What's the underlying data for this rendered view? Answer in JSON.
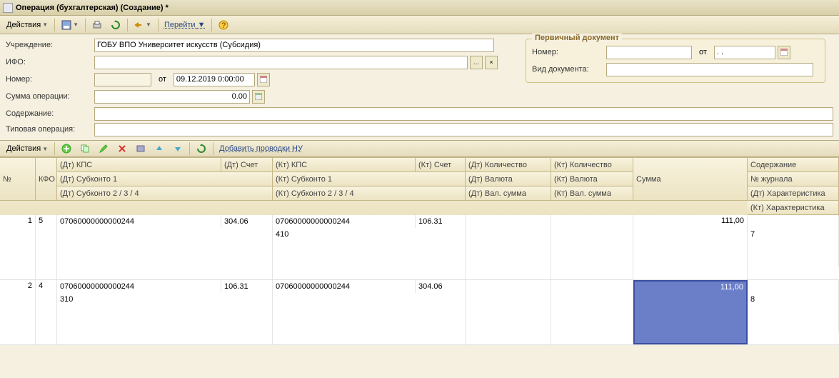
{
  "window": {
    "title": "Операция (бухгалтерская) (Создание) *"
  },
  "toolbar1": {
    "actions": "Действия",
    "go": "Перейти"
  },
  "form": {
    "institution_label": "Учреждение:",
    "institution_value": "ГОБУ ВПО Университет искусств (Субсидия)",
    "ifo_label": "ИФО:",
    "ifo_value": "",
    "number_label": "Номер:",
    "number_value": "",
    "from_label": "от",
    "date_value": "09.12.2019 0:00:00",
    "sum_label": "Сумма операции:",
    "sum_value": "0.00",
    "content_label": "Содержание:",
    "content_value": "",
    "typical_label": "Типовая операция:",
    "typical_value": ""
  },
  "primary_doc": {
    "legend": "Первичный документ",
    "number_label": "Номер:",
    "number_value": "",
    "from_label": "от",
    "date_value": ". .",
    "type_label": "Вид документа:",
    "type_value": ""
  },
  "toolbar2": {
    "actions": "Действия",
    "add_nu": "Добавить проводки НУ"
  },
  "grid_headers": {
    "no": "№",
    "kfo": "КФО",
    "dt_kps": "(Дт) КПС",
    "dt_acct": "(Дт) Счет",
    "kt_kps": "(Кт) КПС",
    "kt_acct": "(Кт) Счет",
    "dt_qty": "(Дт) Количество",
    "kt_qty": "(Кт) Количество",
    "sum": "Сумма",
    "desc": "Содержание",
    "dt_sub1": "(Дт) Субконто 1",
    "kt_sub1": "(Кт) Субконто 1",
    "dt_cur": "(Дт) Валюта",
    "kt_cur": "(Кт) Валюта",
    "journal": "№ журнала",
    "dt_sub234": "(Дт) Субконто 2 / 3 / 4",
    "kt_sub234": "(Кт) Субконто 2 / 3 / 4",
    "dt_cursum": "(Дт) Вал. сумма",
    "kt_cursum": "(Кт) Вал. сумма",
    "dt_char": "(Дт) Характеристика",
    "kt_char": "(Кт) Характеристика"
  },
  "rows": [
    {
      "no": "1",
      "kfo": "5",
      "dt_kps": "07060000000000244",
      "dt_acct": "304.06",
      "kt_kps": "07060000000000244",
      "kt_acct": "106.31",
      "sum": "111,00",
      "kt_sub1": "410",
      "journal": "7"
    },
    {
      "no": "2",
      "kfo": "4",
      "dt_kps": "07060000000000244",
      "dt_acct": "106.31",
      "kt_kps": "07060000000000244",
      "kt_acct": "304.06",
      "sum": "111,00",
      "dt_sub1": "310",
      "journal": "8",
      "selected": true
    }
  ]
}
